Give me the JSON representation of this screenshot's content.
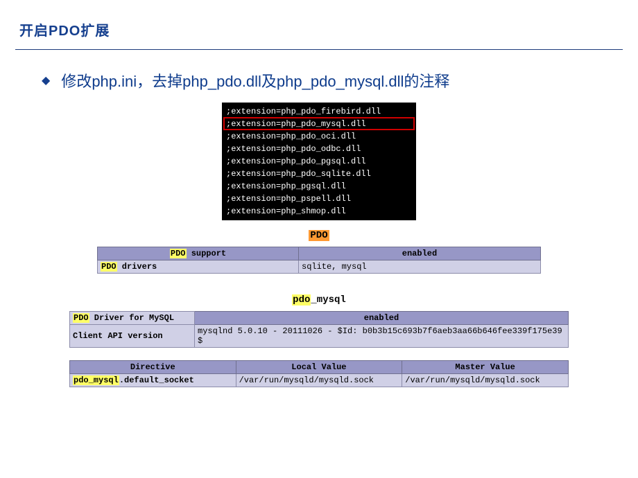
{
  "header": {
    "title": "开启PDO扩展"
  },
  "bullet": {
    "text": "修改php.ini，去掉php_pdo.dll及php_pdo_mysql.dll的注释"
  },
  "code": {
    "lines": [
      ";extension=php_pdo_firebird.dll",
      ";extension=php_pdo_mysql.dll",
      ";extension=php_pdo_oci.dll",
      ";extension=php_pdo_odbc.dll",
      ";extension=php_pdo_pgsql.dll",
      ";extension=php_pdo_sqlite.dll",
      ";extension=php_pgsql.dll",
      ";extension=php_pspell.dll",
      ";extension=php_shmop.dll"
    ]
  },
  "section1": {
    "label_hl": "PDO",
    "row1": {
      "h1_hl": "PDO",
      "h1_rest": " support",
      "h2": "enabled"
    },
    "row2": {
      "k_hl": "PDO",
      "k_rest": " drivers",
      "v": "sqlite, mysql"
    }
  },
  "section2": {
    "label_hl": "pdo",
    "label_rest": "_mysql",
    "row1": {
      "k_hl": "PDO",
      "k_rest": " Driver for MySQL",
      "v": "enabled"
    },
    "row2": {
      "k": "Client API version",
      "v": "mysqlnd 5.0.10 - 20111026 - $Id: b0b3b15c693b7f6aeb3aa66b646fee339f175e39 $"
    }
  },
  "section3": {
    "headers": {
      "h1": "Directive",
      "h2": "Local Value",
      "h3": "Master Value"
    },
    "row": {
      "k_hl": "pdo_mysql",
      "k_rest": ".default_socket",
      "v1": "/var/run/mysqld/mysqld.sock",
      "v2": "/var/run/mysqld/mysqld.sock"
    }
  }
}
